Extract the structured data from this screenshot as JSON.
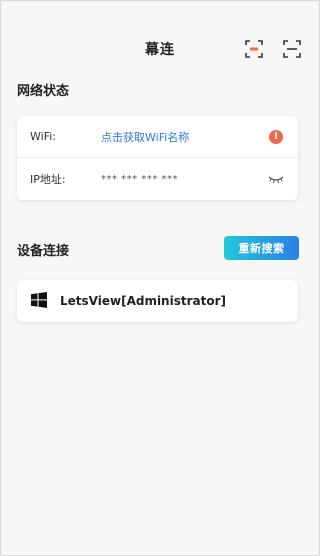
{
  "header": {
    "title": "幕连",
    "scan_cast_icon": "scan-cast-icon",
    "scan_icon": "scan-icon"
  },
  "network": {
    "section_title": "网络状态",
    "wifi": {
      "label": "WiFi:",
      "value": "点击获取WiFi名称",
      "status_icon": "warning-icon",
      "status_color": "#f0684c"
    },
    "ip": {
      "label": "IP地址:",
      "value": "*** *** *** ***",
      "visibility_icon": "eye-closed-icon"
    }
  },
  "devices": {
    "section_title": "设备连接",
    "research_label": "重新搜索",
    "list": [
      {
        "name": "LetsView[Administrator]",
        "icon": "windows-icon"
      }
    ]
  },
  "colors": {
    "accent_gradient_start": "#21c8d6",
    "accent_gradient_end": "#2b7fe4",
    "link": "#2f7ad8",
    "warning": "#f0684c"
  }
}
